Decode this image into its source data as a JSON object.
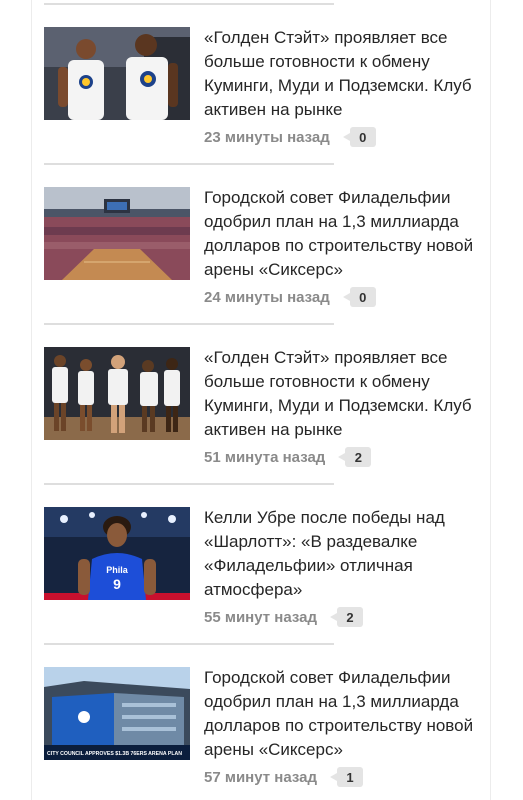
{
  "feed": {
    "items": [
      {
        "title": "«Голден Стэйт» проявляет все больше готовности к обмену Куминги, Муди и Подземски. Клуб активен на рынке",
        "time": "23 минуты назад",
        "comments": "0",
        "image": "two-warriors-players-photo"
      },
      {
        "title": "Городской совет Филадельфии одобрил план на 1,3 миллиарда долларов по строительству новой арены «Сиксерс»",
        "time": "24 минуты назад",
        "comments": "0",
        "image": "arena-interior-rendering"
      },
      {
        "title": "«Голден Стэйт» проявляет все больше готовности к обмену Куминги, Муди и Подземски. Клуб активен на рынке",
        "time": "51 минута назад",
        "comments": "2",
        "image": "warriors-team-on-court-photo"
      },
      {
        "title": "Келли Убре после победы над «Шарлотт»: «В раздевалке «Филадельфии» отличная атмосфера»",
        "time": "55 минут назад",
        "comments": "2",
        "image": "kelly-oubre-sixers-photo"
      },
      {
        "title": "Городской совет Филадельфии одобрил план на 1,3 миллиарда долларов по строительству новой арены «Сиксерс»",
        "time": "57 минут назад",
        "comments": "1",
        "image": "arena-exterior-rendering",
        "caption": "CITY COUNCIL APPROVES $1.3B 76ERS ARENA PLAN"
      }
    ]
  }
}
